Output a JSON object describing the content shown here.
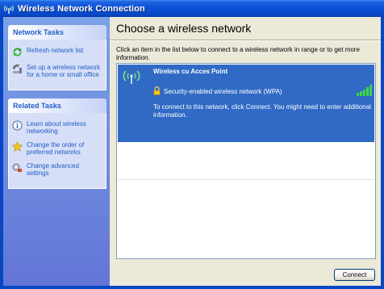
{
  "window": {
    "title": "Wireless Network Connection",
    "title_icon": "wireless-icon"
  },
  "sidebar": {
    "network_tasks": {
      "header": "Network Tasks",
      "items": [
        {
          "label": "Refresh network list",
          "icon": "refresh-icon"
        },
        {
          "label": "Set up a wireless network for a home or small office",
          "icon": "setup-wizard-icon"
        }
      ]
    },
    "related_tasks": {
      "header": "Related Tasks",
      "items": [
        {
          "label": "Learn about wireless networking",
          "icon": "info-icon"
        },
        {
          "label": "Change the order of preferred networks",
          "icon": "star-icon"
        },
        {
          "label": "Change advanced settings",
          "icon": "settings-icon"
        }
      ]
    }
  },
  "main": {
    "heading": "Choose a wireless network",
    "instructions": "Click an item in the list below to connect to a wireless network in range or to get more information.",
    "networks": [
      {
        "ssid": "Wireless cu Acces Point",
        "security": "Security-enabled wireless network (WPA)",
        "note": "To connect to this network, click Connect. You might need to enter additional information.",
        "signal_bars": 5,
        "selected": true
      }
    ],
    "connect_label": "Connect"
  },
  "colors": {
    "title_bar": "#0a4fd6",
    "selection": "#316ac5",
    "task_link": "#215dc6",
    "task_pane": "#7ba2e7"
  }
}
